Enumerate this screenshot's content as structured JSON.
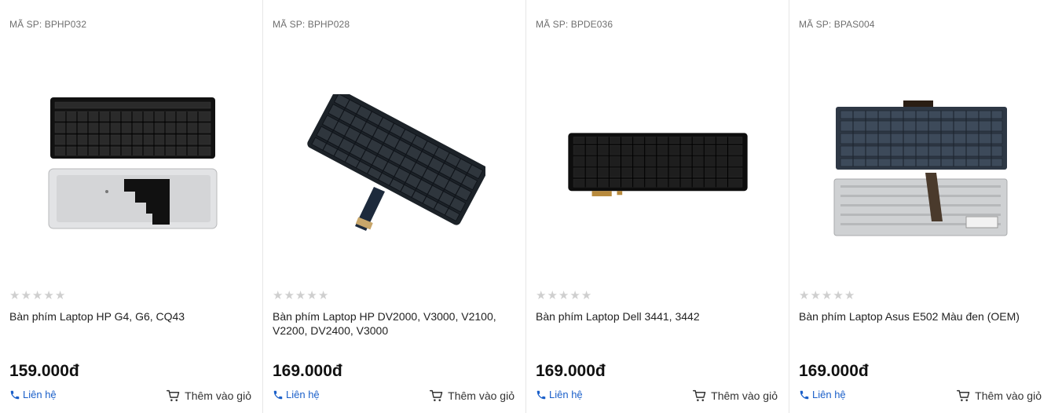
{
  "products": [
    {
      "sku": "MÃ SP: BPHP032",
      "name": "Bàn phím Laptop HP G4, G6, CQ43",
      "price": "159.000đ",
      "rating_stars": 0,
      "image_icon": "keyboard-front-back-icon",
      "contact_label": "Liên hệ",
      "cart_label": "Thêm vào giỏ"
    },
    {
      "sku": "MÃ SP: BPHP028",
      "name": "Bàn phím Laptop HP DV2000, V3000, V2100, V2200, DV2400, V3000",
      "price": "169.000đ",
      "rating_stars": 0,
      "image_icon": "keyboard-angled-icon",
      "contact_label": "Liên hệ",
      "cart_label": "Thêm vào giỏ"
    },
    {
      "sku": "MÃ SP: BPDE036",
      "name": "Bàn phím Laptop Dell 3441, 3442",
      "price": "169.000đ",
      "rating_stars": 0,
      "image_icon": "keyboard-backlit-icon",
      "contact_label": "Liên hệ",
      "cart_label": "Thêm vào giỏ"
    },
    {
      "sku": "MÃ SP: BPAS004",
      "name": "Bàn phím Laptop Asus E502 Màu đen (OEM)",
      "price": "169.000đ",
      "rating_stars": 0,
      "image_icon": "keyboard-front-back-icon",
      "contact_label": "Liên hệ",
      "cart_label": "Thêm vào giỏ"
    }
  ],
  "colors": {
    "link": "#1a5fc9",
    "star_empty": "#cfcfcf",
    "sku_text": "#6f6f6f"
  }
}
